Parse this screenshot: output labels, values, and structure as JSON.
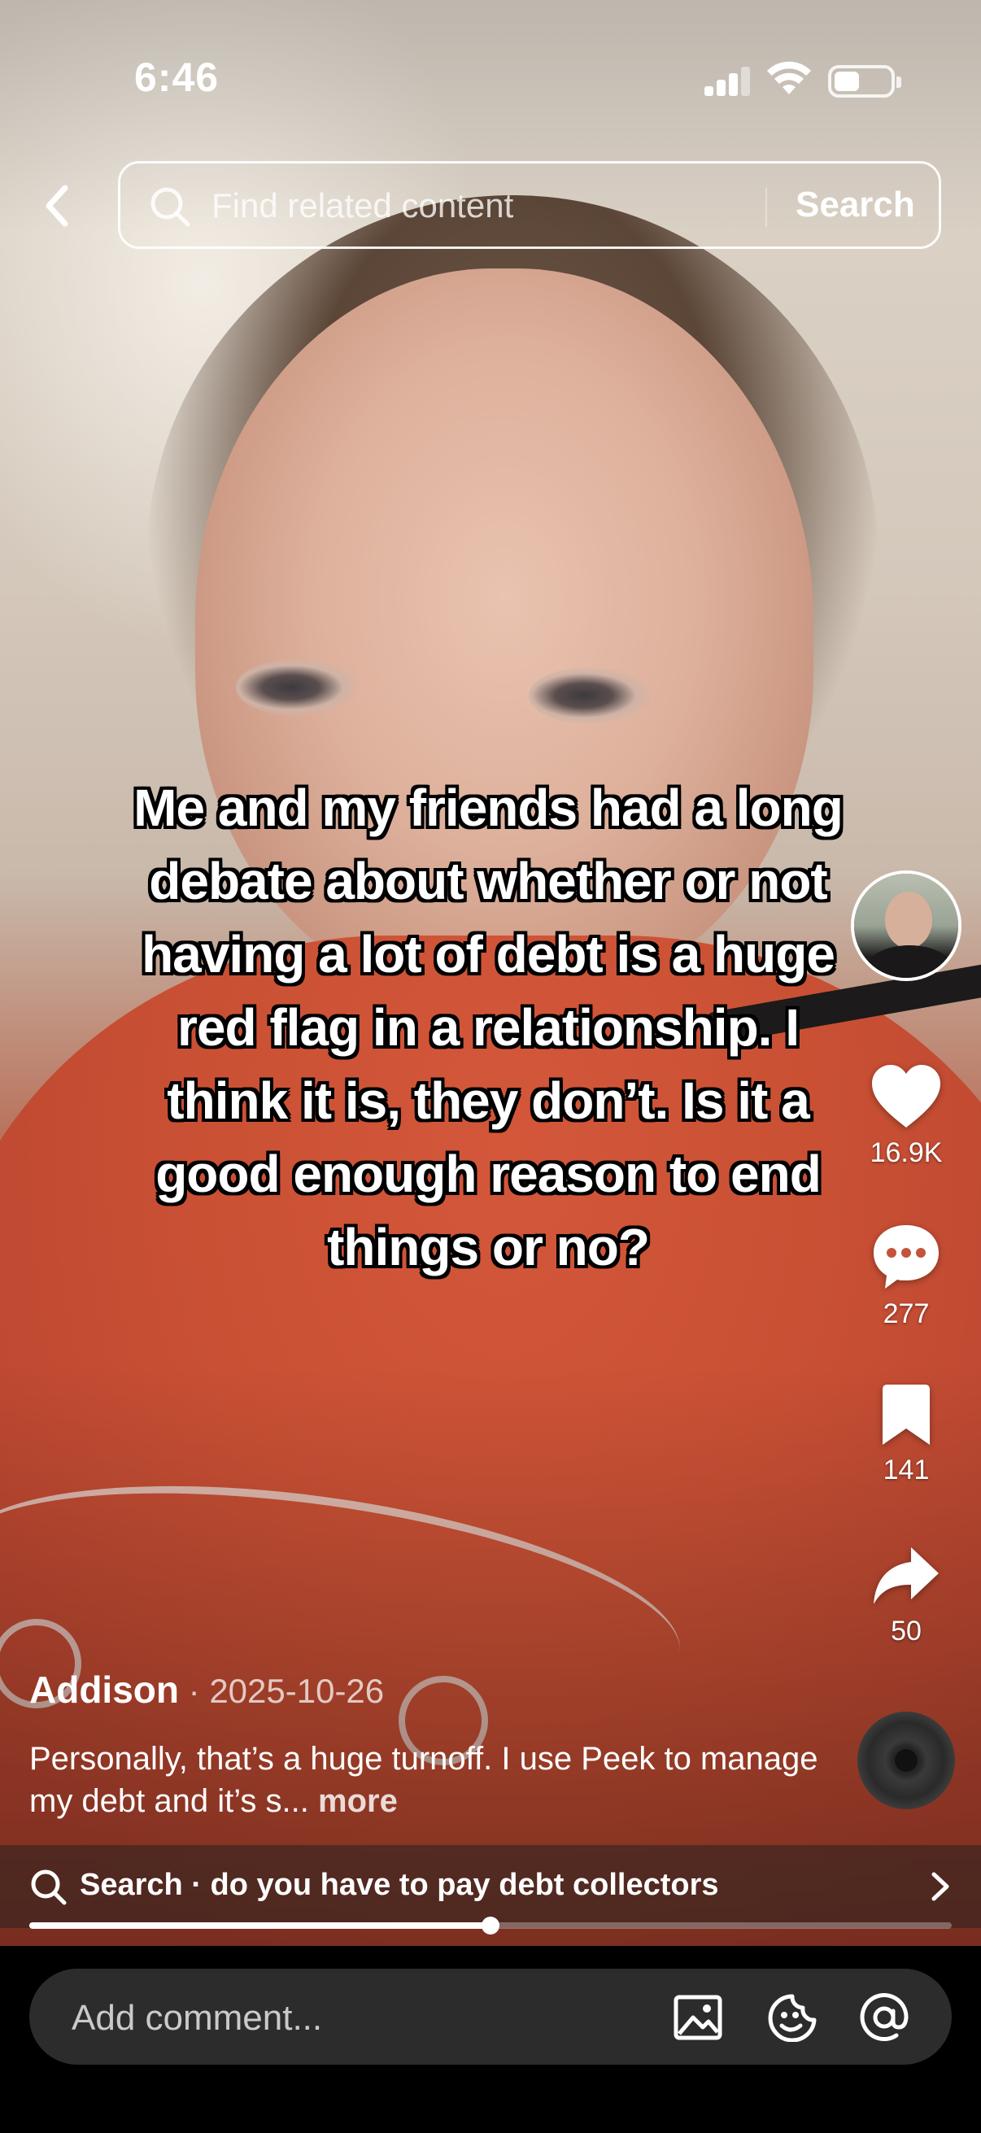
{
  "status_bar": {
    "time": "6:46",
    "battery_level": 0.45
  },
  "top_search": {
    "placeholder": "Find related content",
    "button_label": "Search"
  },
  "caption_overlay": "Me and my friends had a long debate about whether or not having a lot of debt is a huge red flag in a relationship. I think it is, they don’t. Is it a good enough reason to end things or no?",
  "right_rail": {
    "likes": "16.9K",
    "comments": "277",
    "bookmarks": "141",
    "shares": "50"
  },
  "post": {
    "author": "Addison",
    "date_separator": " · ",
    "date": "2025-10-26",
    "description": "Personally, that’s a huge turnoff. I use Peek to manage my debt and it’s s...",
    "more_label": "more"
  },
  "search_suggestion": {
    "text": "Search · do you have to pay debt collectors"
  },
  "playback": {
    "progress": 0.5
  },
  "comment_bar": {
    "placeholder": "Add comment..."
  },
  "icons": {
    "back": "chevron-left-icon",
    "search": "magnifier-icon",
    "like": "heart-icon",
    "comment": "speech-bubble-icon",
    "bookmark": "bookmark-icon",
    "share": "share-arrow-icon",
    "image": "image-icon",
    "emoji": "emoji-icon",
    "mention": "at-sign-icon"
  }
}
